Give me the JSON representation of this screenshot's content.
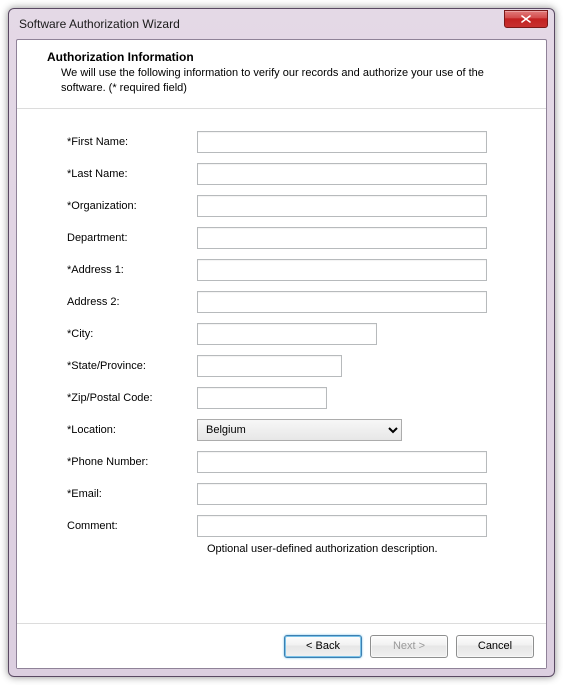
{
  "window": {
    "title": "Software Authorization Wizard"
  },
  "header": {
    "title": "Authorization Information",
    "description": "We will use the following information to verify our records and authorize your use of the software. (* required field)"
  },
  "form": {
    "first_name": {
      "label": "*First Name:",
      "value": ""
    },
    "last_name": {
      "label": "*Last Name:",
      "value": ""
    },
    "organization": {
      "label": "*Organization:",
      "value": ""
    },
    "department": {
      "label": "Department:",
      "value": ""
    },
    "address1": {
      "label": "*Address 1:",
      "value": ""
    },
    "address2": {
      "label": "Address 2:",
      "value": ""
    },
    "city": {
      "label": "*City:",
      "value": ""
    },
    "state": {
      "label": "*State/Province:",
      "value": ""
    },
    "zip": {
      "label": "*Zip/Postal Code:",
      "value": ""
    },
    "location": {
      "label": "*Location:",
      "value": "Belgium"
    },
    "phone": {
      "label": "*Phone Number:",
      "value": ""
    },
    "email": {
      "label": "*Email:",
      "value": ""
    },
    "comment": {
      "label": "Comment:",
      "value": ""
    },
    "comment_helper": "Optional user-defined authorization description."
  },
  "footer": {
    "back": "< Back",
    "next": "Next >",
    "cancel": "Cancel"
  }
}
